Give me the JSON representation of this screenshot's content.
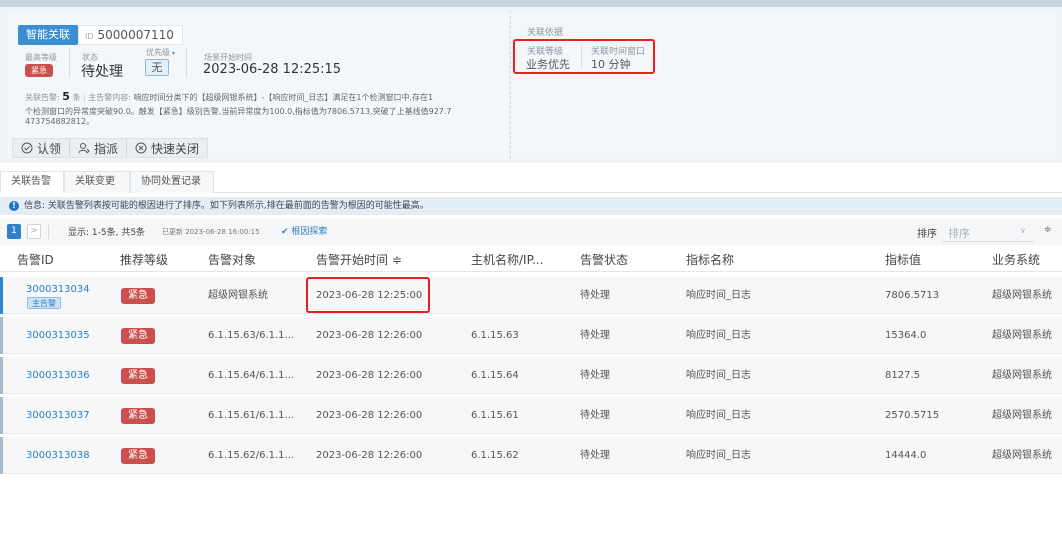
{
  "header": {
    "tag": "智能关联",
    "id_label": "ID",
    "id_value": "5000007110",
    "max_level_label": "最高等级",
    "max_level_value": "紧急",
    "status_label": "状态",
    "status_value": "待处理",
    "priority_label": "优先级",
    "priority_value": "无",
    "start_time_label": "场景开始时间",
    "start_time_value": "2023-06-28 12:25:15",
    "summary_prefix": "关联告警:",
    "summary_count": "5",
    "summary_count_unit": "条",
    "summary_main_label": "主告警内容:",
    "summary_line1": "响应时间分类下的【超级网银系统】-【响应时间_日志】满足在1个检测窗口中,存在1",
    "summary_line2": "个检测窗口的异常度突破90.0。触发【紧急】级别告警,当前异常度为100.0,指标值为7806.5713,突破了上基线值927.7",
    "summary_line3": "473754882812。",
    "actions": [
      "认领",
      "指派",
      "快速关闭"
    ]
  },
  "basis": {
    "title": "关联依据",
    "level_label": "关联等级",
    "level_value": "业务优先",
    "window_label": "关联时间窗口",
    "window_value": "10 分钟"
  },
  "tabs": [
    "关联告警",
    "关联变更",
    "协同处置记录"
  ],
  "info": "信息: 关联告警列表按可能的根因进行了排序。如下列表所示,排在最前面的告警为根因的可能性最高。",
  "pager": {
    "page": "1",
    "next": ">",
    "display": "显示: 1-5条, 共5条",
    "updated": "已更新 2023-06-28 16:00:15",
    "root_cause": "根因探索",
    "sort_label": "排序",
    "sort_placeholder": "排序"
  },
  "table": {
    "columns": [
      "告警ID",
      "推荐等级",
      "告警对象",
      "告警开始时间 ≑",
      "主机名称/IP...",
      "告警状态",
      "指标名称",
      "指标值",
      "业务系统"
    ],
    "main_alarm_tag": "主告警",
    "rows": [
      [
        "3000313034",
        "紧急",
        "超级网银系统",
        "2023-06-28 12:25:00",
        "",
        "待处理",
        "响应时间_日志",
        "7806.5713",
        "超级网银系统"
      ],
      [
        "3000313035",
        "紧急",
        "6.1.15.63/6.1.1...",
        "2023-06-28 12:26:00",
        "6.1.15.63",
        "待处理",
        "响应时间_日志",
        "15364.0",
        "超级网银系统"
      ],
      [
        "3000313036",
        "紧急",
        "6.1.15.64/6.1.1...",
        "2023-06-28 12:26:00",
        "6.1.15.64",
        "待处理",
        "响应时间_日志",
        "8127.5",
        "超级网银系统"
      ],
      [
        "3000313037",
        "紧急",
        "6.1.15.61/6.1.1...",
        "2023-06-28 12:26:00",
        "6.1.15.61",
        "待处理",
        "响应时间_日志",
        "2570.5715",
        "超级网银系统"
      ],
      [
        "3000313038",
        "紧急",
        "6.1.15.62/6.1.1...",
        "2023-06-28 12:26:00",
        "6.1.15.62",
        "待处理",
        "响应时间_日志",
        "14444.0",
        "超级网银系统"
      ]
    ]
  },
  "colors": {
    "accent": "#2e7fc6",
    "urgent": "#c9504e",
    "highlight": "#e8211c"
  }
}
